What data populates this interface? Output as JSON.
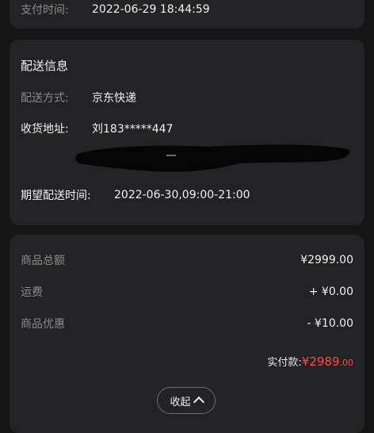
{
  "payment": {
    "label": "支付时间:",
    "value": "2022-06-29 18:44:59"
  },
  "delivery": {
    "title": "配送信息",
    "method_label": "配送方式:",
    "method_value": "京东快递",
    "address_label": "收货地址:",
    "address_value": "刘183*****447",
    "expect_label": "期望配送时间:",
    "expect_value": "2022-06-30,09:00-21:00"
  },
  "price": {
    "items": [
      {
        "label": "商品总额",
        "value": "¥2999.00"
      },
      {
        "label": "运费",
        "value": "+ ¥0.00"
      },
      {
        "label": "商品优惠",
        "value": "- ¥10.00"
      }
    ],
    "pay_label": "实付款:",
    "pay_currency": "¥",
    "pay_amount": "2989",
    "pay_decimals": ".00",
    "collapse_label": "收起"
  },
  "colors": {
    "background": "#151515",
    "card": "#232325",
    "accent": "#ff4b43"
  }
}
